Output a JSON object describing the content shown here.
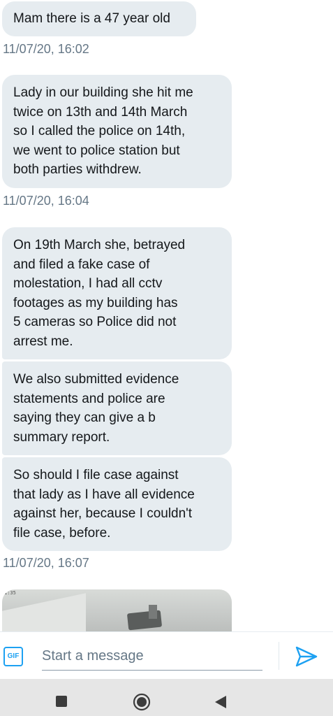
{
  "messages": [
    {
      "text": "Mam there is a 47 year old"
    },
    {
      "text": "Lady in our building she hit me\ntwice on 13th and 14th March\nso I called the police on 14th,\nwe went to police station but\nboth parties withdrew."
    },
    {
      "text": "On 19th March she, betrayed\nand filed a fake case of\nmolestation, I had all cctv\nfootages as my building has\n5 cameras so Police did not\narrest me."
    },
    {
      "text": "We also submitted evidence\nstatements and police are\nsaying they can give a b\nsummary report."
    },
    {
      "text": "So should I file case against\nthat lady as I have all evidence\nagainst her, because I couldn't\nfile case, before."
    }
  ],
  "timestamps": [
    "11/07/20, 16:02",
    "11/07/20, 16:04",
    "11/07/20, 16:07"
  ],
  "media": {
    "cam_label": "1:35",
    "icon": "cctv-image"
  },
  "composer": {
    "gif_label": "GIF",
    "placeholder": "Start a message",
    "send_icon": "send-icon"
  },
  "navbar": {
    "icons": [
      "recent-apps-icon",
      "home-icon",
      "back-icon"
    ]
  },
  "colors": {
    "accent": "#1da1f2",
    "bubble": "#e6ecf0",
    "timestamp": "#657786",
    "navbar": "#e6e6e6"
  }
}
